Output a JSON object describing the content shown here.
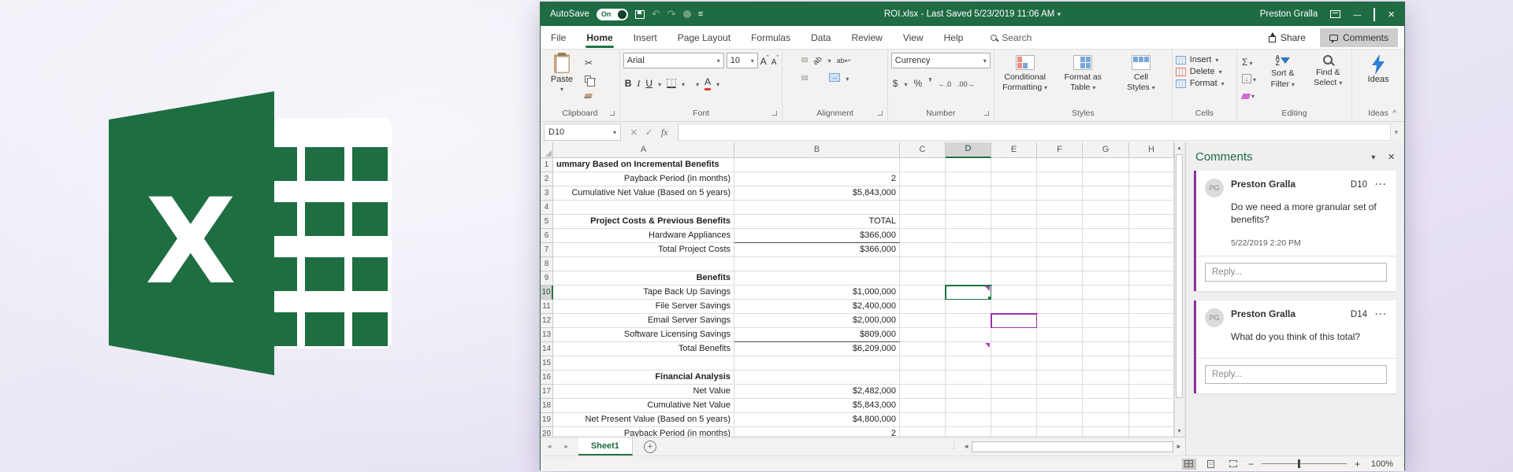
{
  "colors": {
    "titlebar_green": "#1f6b43",
    "accent_green": "#217346",
    "presence_purple": "#9b30b4",
    "logo_green": "#1e6e42"
  },
  "logo": {
    "letter": "X"
  },
  "titlebar": {
    "autosave_label": "AutoSave",
    "autosave_state": "On",
    "document_title": "ROI.xlsx",
    "separator": "-",
    "saved_status": "Last Saved 5/23/2019 11:06 AM",
    "user_name": "Preston Gralla"
  },
  "ribbon_tabs": {
    "file": "File",
    "items": [
      "Home",
      "Insert",
      "Page Layout",
      "Formulas",
      "Data",
      "Review",
      "View",
      "Help"
    ],
    "active": "Home",
    "search_label": "Search",
    "share_label": "Share",
    "comments_label": "Comments"
  },
  "ribbon": {
    "clipboard": {
      "label": "Clipboard",
      "paste": "Paste"
    },
    "font": {
      "label": "Font",
      "family": "Arial",
      "size": "10"
    },
    "alignment": {
      "label": "Alignment"
    },
    "number": {
      "label": "Number",
      "format": "Currency"
    },
    "styles": {
      "label": "Styles",
      "buttons": [
        [
          "Conditional",
          "Formatting"
        ],
        [
          "Format as",
          "Table"
        ],
        [
          "Cell",
          "Styles"
        ]
      ]
    },
    "cells": {
      "label": "Cells",
      "buttons": [
        "Insert",
        "Delete",
        "Format"
      ]
    },
    "editing": {
      "label": "Editing",
      "buttons": [
        [
          "Sort &",
          "Filter"
        ],
        [
          "Find &",
          "Select"
        ]
      ]
    },
    "ideas": {
      "label": "Ideas",
      "button": "Ideas"
    }
  },
  "formula_bar": {
    "name_box": "D10",
    "value": ""
  },
  "sheet": {
    "columns": [
      "A",
      "B",
      "C",
      "D",
      "E",
      "F",
      "G",
      "H"
    ],
    "active_cell": "D10",
    "presence_cell": "E12",
    "flag_cells": [
      "D10",
      "D14"
    ],
    "rows": [
      {
        "n": "1",
        "a": "ummary Based on Incremental Benefits",
        "b": "",
        "bold": true,
        "align": "left"
      },
      {
        "n": "2",
        "a": "Payback Period (in months)",
        "b": "2"
      },
      {
        "n": "3",
        "a": "Cumulative Net Value  (Based on 5 years)",
        "b": "$5,843,000"
      },
      {
        "n": "4",
        "a": "",
        "b": ""
      },
      {
        "n": "5",
        "a": "Project Costs & Previous Benefits",
        "b": "TOTAL",
        "bold": true
      },
      {
        "n": "6",
        "a": "Hardware Appliances",
        "b": "$366,000",
        "b_border": true
      },
      {
        "n": "7",
        "a": "Total Project Costs",
        "b": "$366,000"
      },
      {
        "n": "8",
        "a": "",
        "b": ""
      },
      {
        "n": "9",
        "a": "Benefits",
        "b": "",
        "bold": true
      },
      {
        "n": "10",
        "a": "Tape Back Up Savings",
        "b": "$1,000,000"
      },
      {
        "n": "11",
        "a": "File Server Savings",
        "b": "$2,400,000"
      },
      {
        "n": "12",
        "a": "Email Server Savings",
        "b": "$2,000,000"
      },
      {
        "n": "13",
        "a": "Software Licensing Savings",
        "b": "$809,000",
        "b_border": true
      },
      {
        "n": "14",
        "a": "Total Benefits",
        "b": "$6,209,000"
      },
      {
        "n": "15",
        "a": "",
        "b": ""
      },
      {
        "n": "16",
        "a": "Financial Analysis",
        "b": "",
        "bold": true
      },
      {
        "n": "17",
        "a": "Net Value",
        "b": "$2,482,000"
      },
      {
        "n": "18",
        "a": "Cumulative Net Value",
        "b": "$5,843,000"
      },
      {
        "n": "19",
        "a": "Net Present Value (Based on 5 years)",
        "b": "$4,800,000"
      },
      {
        "n": "20",
        "a": "Payback Period (in months)",
        "b": "2",
        "partial": true
      }
    ]
  },
  "comments_panel": {
    "title": "Comments",
    "cards": [
      {
        "initials": "PG",
        "author": "Preston Gralla",
        "cell_ref": "D10",
        "text": "Do we need a more granular set of benefits?",
        "time": "5/22/2019 2:20 PM",
        "reply_placeholder": "Reply..."
      },
      {
        "initials": "PG",
        "author": "Preston Gralla",
        "cell_ref": "D14",
        "text": "What do you think of this total?",
        "reply_placeholder": "Reply..."
      }
    ]
  },
  "sheet_bar": {
    "active_sheet": "Sheet1",
    "new_sheet_glyph": "+"
  },
  "status_bar": {
    "zoom_level": "100%"
  }
}
